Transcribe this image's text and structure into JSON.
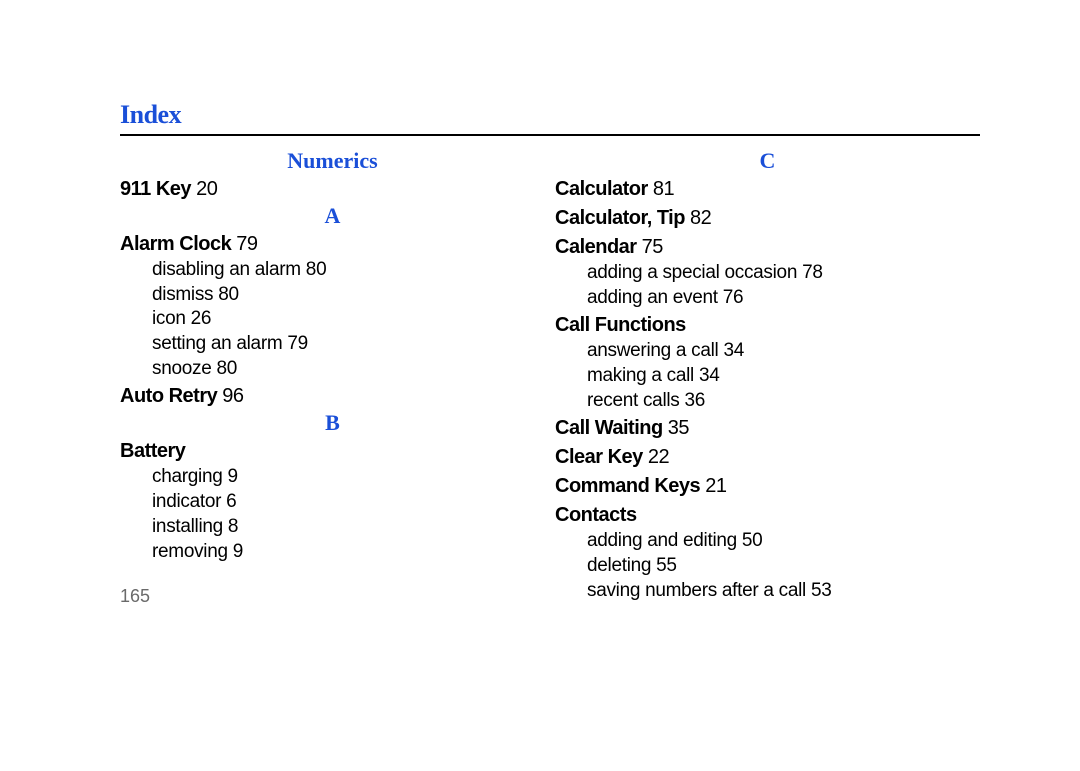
{
  "title": "Index",
  "page_number": "165",
  "left": {
    "section_numerics": "Numerics",
    "e911": {
      "label": "911 Key",
      "page": "20"
    },
    "section_a": "A",
    "alarm_clock": {
      "label": "Alarm Clock",
      "page": "79",
      "subs": [
        {
          "label": "disabling an alarm",
          "page": "80"
        },
        {
          "label": "dismiss",
          "page": "80"
        },
        {
          "label": "icon",
          "page": "26"
        },
        {
          "label": "setting an alarm",
          "page": "79"
        },
        {
          "label": "snooze",
          "page": "80"
        }
      ]
    },
    "auto_retry": {
      "label": "Auto Retry",
      "page": "96"
    },
    "section_b": "B",
    "battery": {
      "label": "Battery",
      "page": "",
      "subs": [
        {
          "label": "charging",
          "page": "9"
        },
        {
          "label": "indicator",
          "page": "6"
        },
        {
          "label": "installing",
          "page": "8"
        },
        {
          "label": "removing",
          "page": "9"
        }
      ]
    }
  },
  "right": {
    "section_c": "C",
    "calculator": {
      "label": "Calculator",
      "page": "81"
    },
    "calculator_tip": {
      "label": "Calculator, Tip",
      "page": "82"
    },
    "calendar": {
      "label": "Calendar",
      "page": "75",
      "subs": [
        {
          "label": "adding a special occasion",
          "page": "78"
        },
        {
          "label": "adding an event",
          "page": "76"
        }
      ]
    },
    "call_functions": {
      "label": "Call Functions",
      "page": "",
      "subs": [
        {
          "label": "answering a call",
          "page": "34"
        },
        {
          "label": "making a call",
          "page": "34"
        },
        {
          "label": "recent calls",
          "page": "36"
        }
      ]
    },
    "call_waiting": {
      "label": "Call Waiting",
      "page": "35"
    },
    "clear_key": {
      "label": "Clear Key",
      "page": "22"
    },
    "command_keys": {
      "label": "Command Keys",
      "page": "21"
    },
    "contacts": {
      "label": "Contacts",
      "page": "",
      "subs": [
        {
          "label": "adding and editing",
          "page": "50"
        },
        {
          "label": "deleting",
          "page": "55"
        },
        {
          "label": "saving numbers after a call",
          "page": "53"
        }
      ]
    }
  }
}
